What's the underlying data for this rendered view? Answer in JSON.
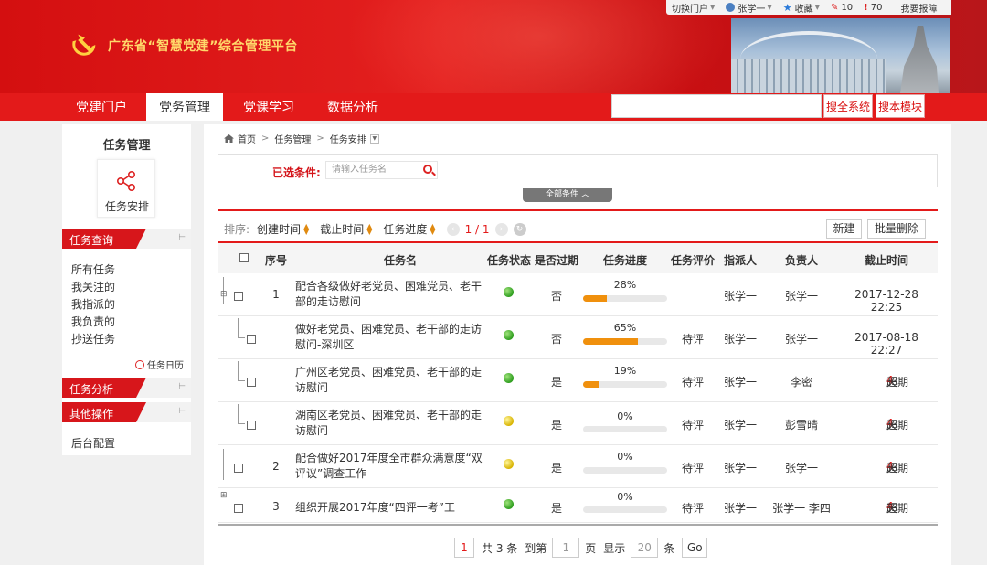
{
  "header": {
    "title": "广东省“智慧党建”综合管理平台",
    "topbar": {
      "switch_portal": "切换门户",
      "user": "张学一",
      "favorites": "收藏",
      "pen_count": "10",
      "alert_count": "70",
      "report": "我要报障"
    }
  },
  "nav": {
    "tabs": [
      "党建门户",
      "党务管理",
      "党课学习",
      "数据分析"
    ],
    "active_tab": "党务管理",
    "search_all": "搜全系统",
    "search_module": "搜本模块"
  },
  "sidebar": {
    "title": "任务管理",
    "card_label": "任务安排",
    "sections": {
      "query": "任务查询",
      "analysis": "任务分析",
      "other": "其他操作"
    },
    "query_links": [
      "所有任务",
      "我关注的",
      "我指派的",
      "我负责的",
      "抄送任务"
    ],
    "calendar": "任务日历",
    "other_links": [
      "后台配置"
    ]
  },
  "breadcrumb": [
    "首页",
    "任务管理",
    "任务安排"
  ],
  "filter": {
    "label": "已选条件:",
    "placeholder": "请输入任务名",
    "all_conditions": "全部条件"
  },
  "sortbar": {
    "label": "排序:",
    "fields": [
      "创建时间",
      "截止时间",
      "任务进度"
    ],
    "page_indicator": "1 / 1"
  },
  "actions": {
    "new": "新建",
    "batch_delete": "批量删除"
  },
  "table": {
    "headers": [
      "序号",
      "任务名",
      "任务状态",
      "是否过期",
      "任务进度",
      "任务评价",
      "指派人",
      "负责人",
      "截止时间"
    ],
    "rows": [
      {
        "idx": "1",
        "name": "配合各级做好老党员、困难党员、老干部的走访慰问",
        "status": "green",
        "expired": "否",
        "progress": 28,
        "progress_label": "28%",
        "rating": "",
        "assigner": "张学一",
        "owner": "张学一",
        "deadline": "2017-12-28 22:25",
        "overdue_days": ""
      },
      {
        "idx": "",
        "name": "做好老党员、困难党员、老干部的走访慰问-深圳区",
        "status": "green",
        "expired": "否",
        "progress": 65,
        "progress_label": "65%",
        "rating": "待评",
        "assigner": "张学一",
        "owner": "张学一",
        "deadline": "2017-08-18 22:27",
        "overdue_days": ""
      },
      {
        "idx": "",
        "name": "广州区老党员、困难党员、老干部的走访慰问",
        "status": "green",
        "expired": "是",
        "progress": 19,
        "progress_label": "19%",
        "rating": "待评",
        "assigner": "张学一",
        "owner": "李密",
        "deadline": "",
        "overdue_days": "4"
      },
      {
        "idx": "",
        "name": "湖南区老党员、困难党员、老干部的走访慰问",
        "status": "yellow",
        "expired": "是",
        "progress": 0,
        "progress_label": "0%",
        "rating": "待评",
        "assigner": "张学一",
        "owner": "彭雪晴",
        "deadline": "",
        "overdue_days": "4"
      },
      {
        "idx": "2",
        "name": "配合做好2017年度全市群众满意度“双评议”调查工作",
        "status": "yellow",
        "expired": "是",
        "progress": 0,
        "progress_label": "0%",
        "rating": "待评",
        "assigner": "张学一",
        "owner": "张学一",
        "deadline": "",
        "overdue_days": "4"
      },
      {
        "idx": "3",
        "name": "组织开展2017年度“四评一考”工",
        "status": "green",
        "expired": "是",
        "progress": 0,
        "progress_label": "0%",
        "rating": "待评",
        "assigner": "张学一",
        "owner": "张学一 李四",
        "deadline": "",
        "overdue_days": "4"
      }
    ],
    "overdue_prefix": "超期",
    "overdue_suffix": "天"
  },
  "pager": {
    "current": "1",
    "total_text": "共 3 条",
    "goto_label": "到第",
    "page_input": "1",
    "page_unit": "页",
    "show_label": "显示",
    "size_input": "20",
    "size_unit": "条",
    "go": "Go"
  },
  "colors": {
    "brand_red": "#e31a1a",
    "progress_orange": "#f0900d",
    "title_gold": "#ffd86a"
  }
}
